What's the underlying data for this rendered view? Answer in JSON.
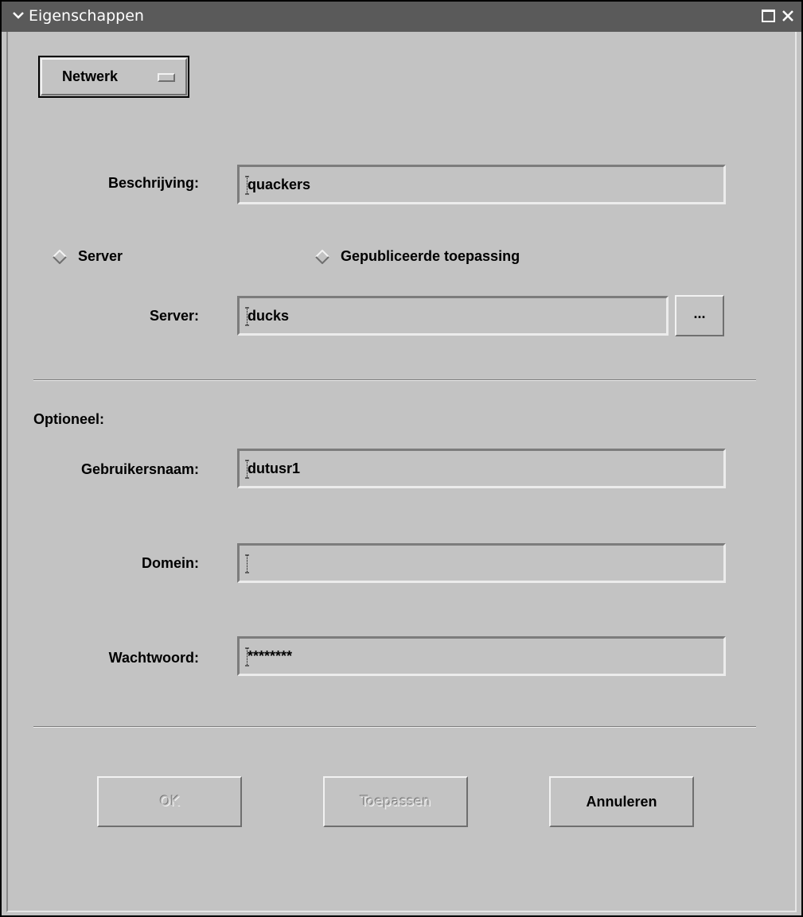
{
  "window": {
    "title": "Eigenschappen"
  },
  "option_menu": {
    "selected": "Netwerk"
  },
  "fields": {
    "description": {
      "label": "Beschrijving:",
      "value": "quackers"
    },
    "server": {
      "label": "Server:",
      "value": "ducks"
    },
    "username": {
      "label": "Gebruikersnaam:",
      "value": "dutusr1"
    },
    "domain": {
      "label": "Domein:",
      "value": ""
    },
    "password": {
      "label": "Wachtwoord:",
      "value": "********"
    }
  },
  "radios": {
    "server": {
      "label": "Server",
      "selected": false
    },
    "published_app": {
      "label": "Gepubliceerde toepassing",
      "selected": false
    }
  },
  "browse_button": {
    "label": "..."
  },
  "optional_heading": "Optioneel:",
  "buttons": {
    "ok": {
      "label": "OK",
      "enabled": false
    },
    "apply": {
      "label": "Toepassen",
      "enabled": false
    },
    "cancel": {
      "label": "Annuleren",
      "enabled": true
    }
  },
  "icons": {
    "title_menu": "chevron-down-icon",
    "maximize": "maximize-icon",
    "close": "close-icon",
    "radio": "diamond-radio-icon"
  },
  "colors": {
    "background": "#c3c3c3",
    "titlebar": "#5a5a5a"
  }
}
